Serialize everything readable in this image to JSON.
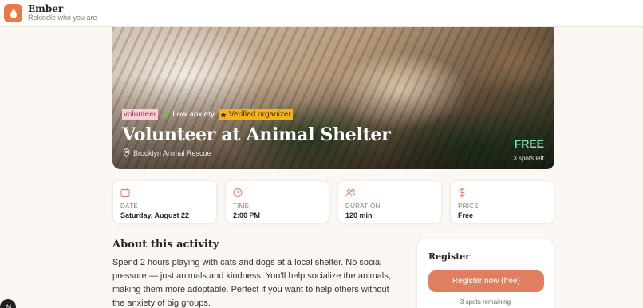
{
  "app": {
    "name": "Ember",
    "tagline": "Rekindle who you are"
  },
  "hero": {
    "tags": [
      "volunteer",
      "Low anxiety",
      "Verified organizer"
    ],
    "title": "Volunteer at Animal Shelter",
    "location": "Brooklyn Animal Rescue",
    "price": "FREE",
    "spots": "3 spots left"
  },
  "info_cards": [
    {
      "icon": "calendar-icon",
      "label": "DATE",
      "value": "Saturday, August 22"
    },
    {
      "icon": "clock-icon",
      "label": "TIME",
      "value": "2:00 PM"
    },
    {
      "icon": "people-icon",
      "label": "DURATION",
      "value": "120 min"
    },
    {
      "icon": "dollar-icon",
      "label": "PRICE",
      "value": "Free"
    }
  ],
  "about": {
    "title": "About this activity",
    "text": "Spend 2 hours playing with cats and dogs at a local shelter. No social pressure — just animals and kindness. You'll help socialize the animals, making them more adoptable. Perfect if you want to help others without the anxiety of big groups."
  },
  "register": {
    "title": "Register",
    "button": "Register now (free)",
    "remaining": "3 spots remaining"
  },
  "colors": {
    "accent": "#e07f60",
    "logo": "#ea7a45",
    "free": "#7ee0b0"
  }
}
